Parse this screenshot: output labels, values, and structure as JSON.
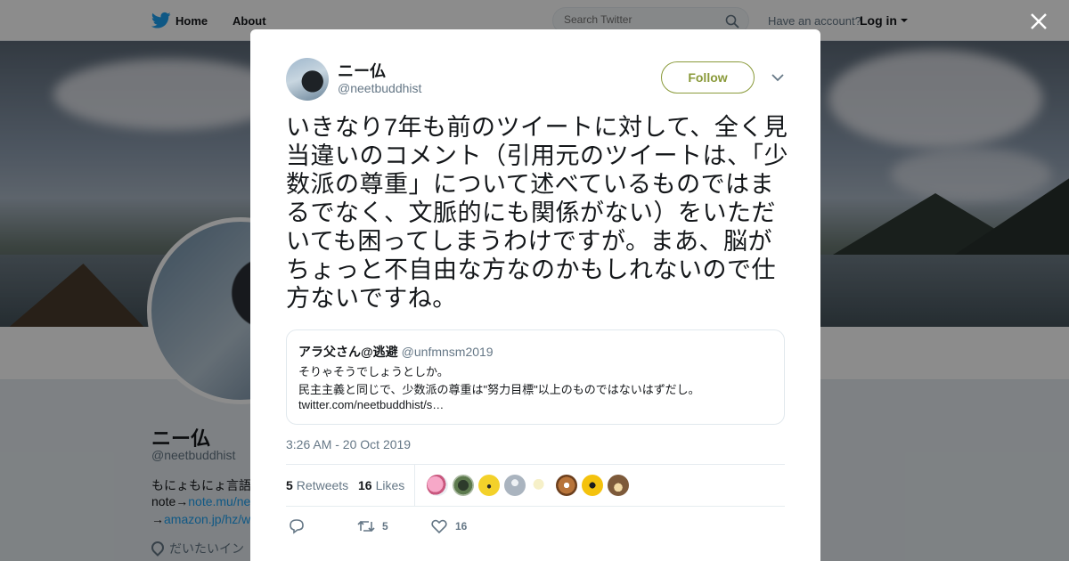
{
  "topbar": {
    "nav_home": "Home",
    "nav_about": "About",
    "search_placeholder": "Search Twitter",
    "account_prompt": "Have an account?",
    "login_label": "Log in"
  },
  "profile": {
    "name": "ニー仏",
    "handle": "@neetbuddhist",
    "bio_line1": "もにょもにょ言語",
    "bio_line2_prefix": "note→",
    "bio_line2_link": "note.mu/ne",
    "bio_line3_prefix": "→",
    "bio_line3_link": "amazon.jp/hz/w",
    "location": "だいたいイン"
  },
  "tweet": {
    "author_name": "ニー仏",
    "author_handle": "@neetbuddhist",
    "follow_label": "Follow",
    "text": "いきなり7年も前のツイートに対して、全く見当違いのコメント（引用元のツイートは、「少数派の尊重」について述べているものではまるでなく、文脈的にも関係がない）をいただいても困ってしまうわけですが。まあ、脳がちょっと不自由な方なのかもしれないので仕方ないですね。",
    "quote": {
      "name": "アラ父さん@逃避",
      "handle": "@unfmnsm2019",
      "line1": "そりゃそうでしょうとしか。",
      "line2": "民主主義と同じで、少数派の尊重は\"努力目標\"以上のものではないはずだし。",
      "line3": "twitter.com/neetbuddhist/s…"
    },
    "timestamp": "3:26 AM - 20 Oct 2019",
    "retweets_count": "5",
    "retweets_label": "Retweets",
    "likes_count": "16",
    "likes_label": "Likes",
    "action_retweet_count": "5",
    "action_like_count": "16"
  },
  "colors": {
    "accent": "#8a9a3a",
    "link": "#1da1f2",
    "twitter_blue": "#1da1f2"
  },
  "icons": [
    "twitter-logo-icon",
    "search-icon",
    "caret-down-icon",
    "close-icon",
    "reply-icon",
    "retweet-icon",
    "heart-icon",
    "location-pin-icon"
  ]
}
